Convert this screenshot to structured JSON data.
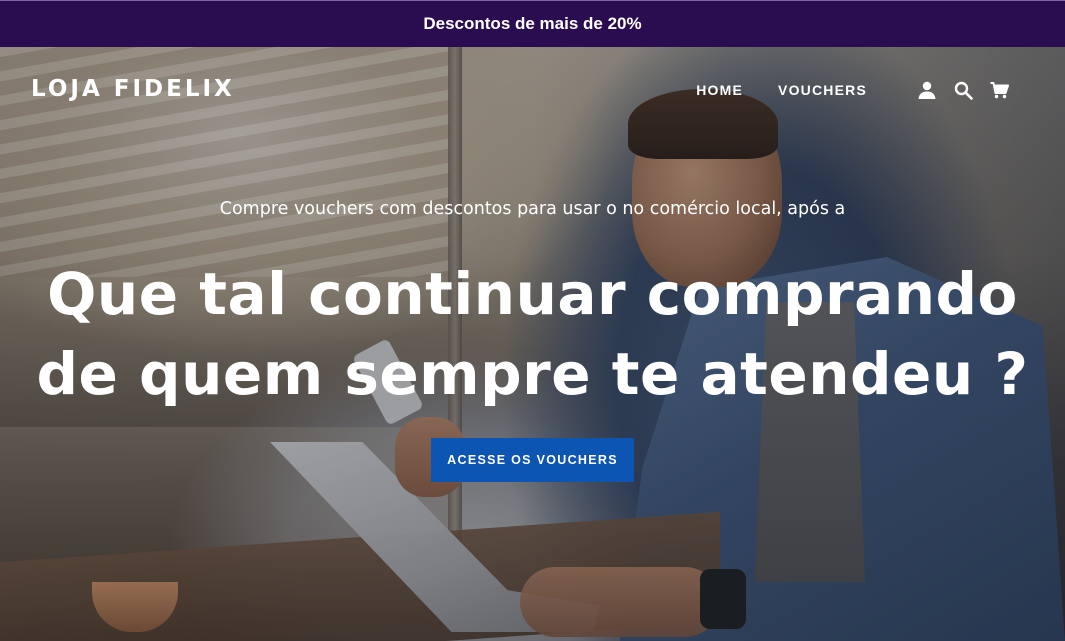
{
  "announcement": {
    "text": "Descontos de mais de 20%"
  },
  "header": {
    "logo": "LOJA FIDELIX",
    "nav": [
      {
        "label": "HOME"
      },
      {
        "label": "VOUCHERS"
      }
    ],
    "icons": [
      "account-icon",
      "search-icon",
      "cart-icon"
    ]
  },
  "hero": {
    "subheading": "Compre vouchers com descontos para usar o no comércio local, após a",
    "headline": "Que tal continuar comprando de quem sempre te atendeu ?",
    "cta_label": "ACESSE OS VOUCHERS"
  },
  "colors": {
    "announcement_bg": "#2a0c51",
    "cta_bg": "#0d55b3",
    "text": "#ffffff"
  }
}
